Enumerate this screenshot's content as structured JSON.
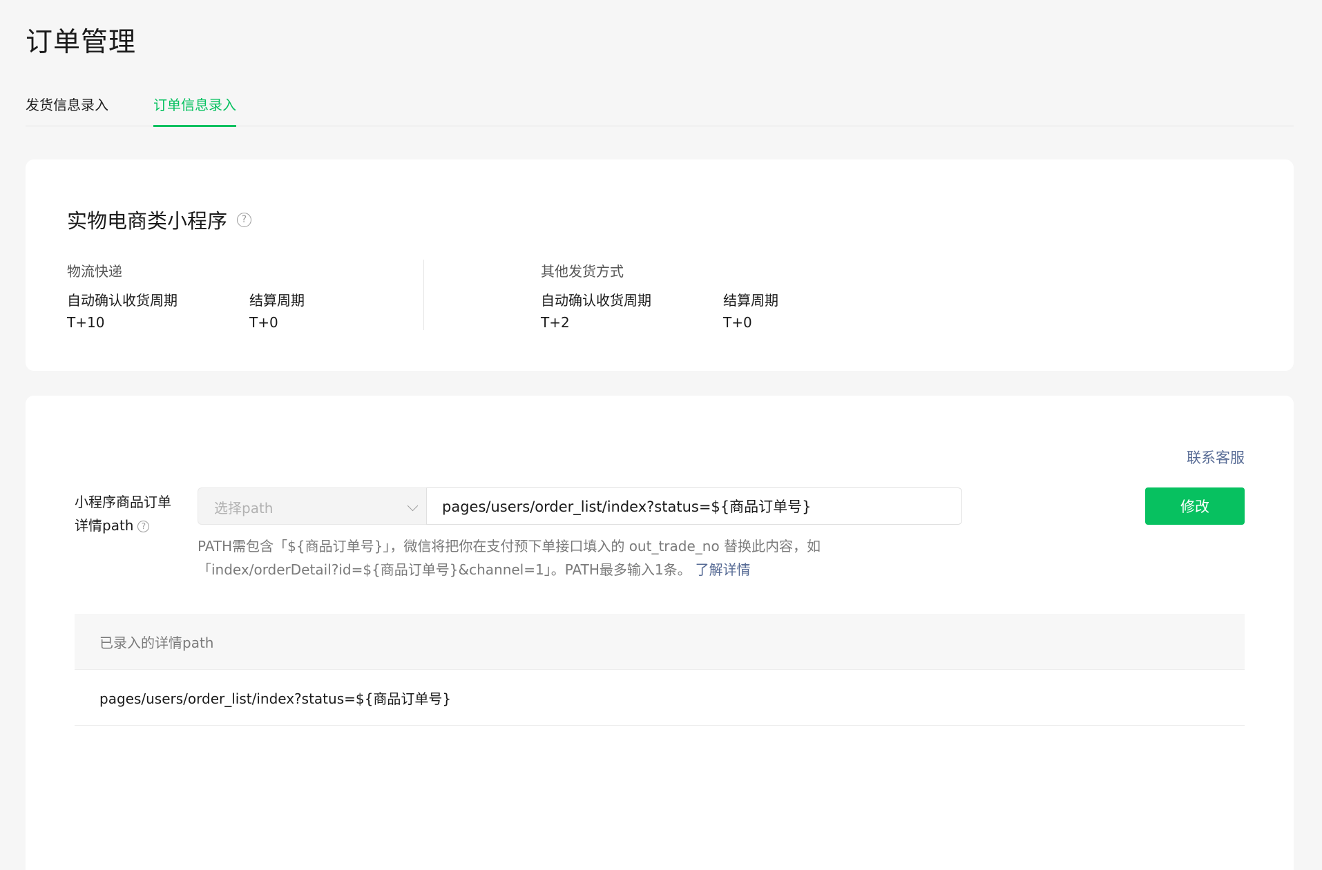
{
  "page": {
    "title": "订单管理"
  },
  "tabs": [
    {
      "label": "发货信息录入",
      "active": false
    },
    {
      "label": "订单信息录入",
      "active": true
    }
  ],
  "ecommerce": {
    "title": "实物电商类小程序",
    "help_icon": "question-circle-icon",
    "express": {
      "heading": "物流快递",
      "confirm_label": "自动确认收货周期",
      "confirm_value": "T+10",
      "settle_label": "结算周期",
      "settle_value": "T+0"
    },
    "other": {
      "heading": "其他发货方式",
      "confirm_label": "自动确认收货周期",
      "confirm_value": "T+2",
      "settle_label": "结算周期",
      "settle_value": "T+0"
    }
  },
  "path_config": {
    "contact_link": "联系客服",
    "label_line1": "小程序商品订单",
    "label_line2": "详情path",
    "select_placeholder": "选择path",
    "input_value": "pages/users/order_list/index?status=${商品订单号}",
    "modify_button": "修改",
    "hint_text": "PATH需包含「${商品订单号}」，微信将把你在支付预下单接口填入的 out_trade_no 替换此内容，如「index/orderDetail?id=${商品订单号}&channel=1」。PATH最多输入1条。",
    "learn_more": "了解详情"
  },
  "paths_table": {
    "header": "已录入的详情path",
    "rows": [
      "pages/users/order_list/index?status=${商品订单号}"
    ]
  },
  "colors": {
    "accent": "#07c160",
    "link": "#576b95"
  }
}
